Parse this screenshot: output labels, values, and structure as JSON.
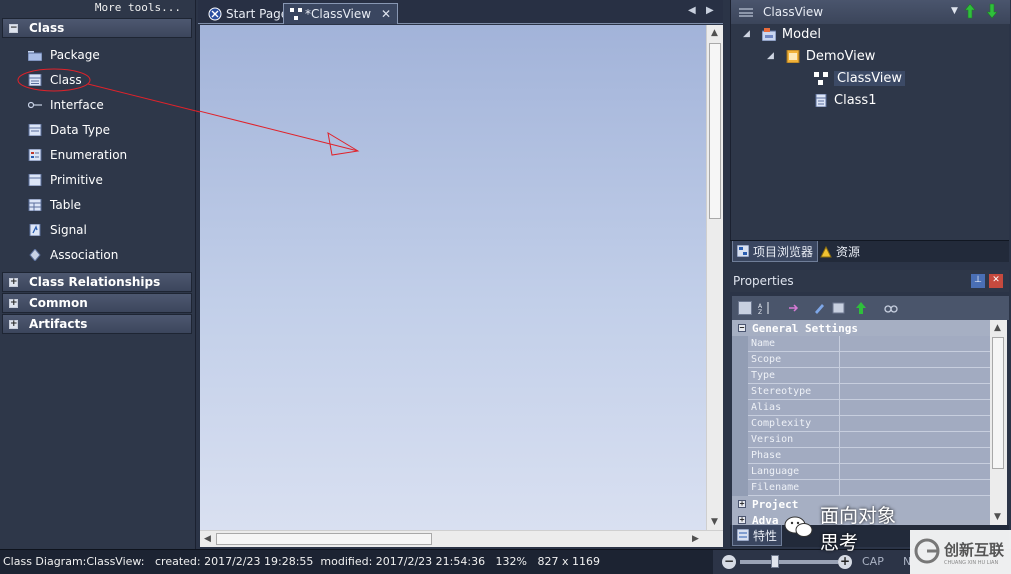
{
  "toolbox": {
    "more_tools": "More tools...",
    "groups": [
      {
        "label": "Class",
        "expanded": true
      },
      {
        "label": "Class Relationships",
        "expanded": false
      },
      {
        "label": "Common",
        "expanded": false
      },
      {
        "label": "Artifacts",
        "expanded": false
      }
    ],
    "items": [
      {
        "label": "Package",
        "icon": "package-icon"
      },
      {
        "label": "Class",
        "icon": "class-icon"
      },
      {
        "label": "Interface",
        "icon": "interface-icon"
      },
      {
        "label": "Data Type",
        "icon": "datatype-icon"
      },
      {
        "label": "Enumeration",
        "icon": "enumeration-icon"
      },
      {
        "label": "Primitive",
        "icon": "primitive-icon"
      },
      {
        "label": "Table",
        "icon": "table-icon"
      },
      {
        "label": "Signal",
        "icon": "signal-icon"
      },
      {
        "label": "Association",
        "icon": "association-icon"
      }
    ]
  },
  "tabs": [
    {
      "label": "Start Page",
      "active": false
    },
    {
      "label": "*ClassView",
      "active": true
    }
  ],
  "project_browser": {
    "title": "ClassView",
    "tree": [
      {
        "label": "Model",
        "level": 0
      },
      {
        "label": "DemoView",
        "level": 1
      },
      {
        "label": "ClassView",
        "level": 2,
        "selected": true
      },
      {
        "label": "Class1",
        "level": 2
      }
    ],
    "tabs": [
      "项目浏览器",
      "资源"
    ]
  },
  "properties": {
    "title": "Properties",
    "categories": [
      {
        "label": "General Settings",
        "expanded": true
      },
      {
        "label": "Project",
        "expanded": false
      },
      {
        "label": "Adva",
        "expanded": false
      }
    ],
    "fields": [
      "Name",
      "Scope",
      "Type",
      "Stereotype",
      "Alias",
      "Complexity",
      "Version",
      "Phase",
      "Language",
      "Filename"
    ],
    "tab": "特性"
  },
  "statusbar": {
    "text": "Class Diagram:ClassView:   created: 2017/2/23 19:28:55  modified: 2017/2/23 21:54:36   132%   827 x 1169",
    "flags": [
      "CAP",
      "N"
    ]
  },
  "watermark": {
    "wechat_text": "面向对象思考",
    "brand_text": "创新互联",
    "brand_sub": "CHUANG XIN HU LIAN"
  },
  "colors": {
    "canvas_top": "#a2b3d9",
    "canvas_bottom": "#d9e0f1",
    "annotation_red": "#e0222a",
    "panel_bg": "#2e3749"
  }
}
